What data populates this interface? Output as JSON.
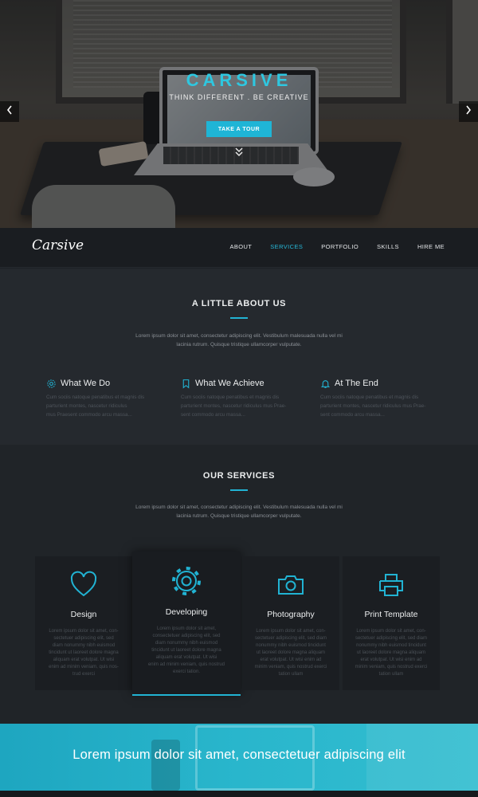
{
  "hero": {
    "brand": "CARSIVE",
    "tagline": "THINK DIFFERENT . BE CREATIVE",
    "cta_label": "TAKE A TOUR",
    "prev_icon": "chevron-left-icon",
    "next_icon": "chevron-right-icon",
    "scroll_icon": "double-chevron-down-icon"
  },
  "nav": {
    "logo": "Carsive",
    "items": [
      {
        "label": "ABOUT",
        "active": false
      },
      {
        "label": "SERVICES",
        "active": true
      },
      {
        "label": "PORTFOLIO",
        "active": false
      },
      {
        "label": "SKILLS",
        "active": false
      },
      {
        "label": "HIRE ME",
        "active": false
      }
    ]
  },
  "about": {
    "title": "A LITTLE ABOUT US",
    "intro_line1": "Lorem ipsum dolor sit amet, consectetur adipiscing elit. Vestibulum malesuada nulla vel mi",
    "intro_line2": "lacinia rutrum. Quisque tristique ullamcorper vulputate.",
    "features": [
      {
        "icon": "gear-icon",
        "title": "What We Do",
        "line1": "Cum sociis natoque penatibus et magnis dis",
        "line2": "parturient montes, nascetur ridiculus",
        "line3": "mus Praesent commodo arcu massa..."
      },
      {
        "icon": "bookmark-icon",
        "title": "What We Achieve",
        "line1": "Cum sociis natoque penatibus et magnis dis",
        "line2": "parturient montes, nascetur ridiculus mus Prae-",
        "line3": "sent commodo arcu massa..."
      },
      {
        "icon": "bell-icon",
        "title": "At The End",
        "line1": "Cum sociis natoque penatibus et magnis dis",
        "line2": "parturient montes, nascetur ridiculus mus Prae-",
        "line3": "sent commodo arcu massa..."
      }
    ]
  },
  "services": {
    "title": "OUR SERVICES",
    "intro_line1": "Lorem ipsum dolor sit amet, consectetur adipiscing elit. Vestibulum malesuada nulla vel mi",
    "intro_line2": "lacinia rutrum. Quisque tristique ullamcorper vulputate.",
    "cards": [
      {
        "icon": "heart-icon",
        "name": "Design",
        "lines": [
          "Lorem ipsum dolor sit amet, con-",
          "sectetuer adipiscing elit, sed",
          "diam nonummy nibh euismod",
          "tincidunt ut laoreet dolore magna",
          "aliquam erat volutpat. Ut wisi",
          "enim ad minim veniam, quis nos-",
          "trud exerci"
        ]
      },
      {
        "icon": "gear-icon",
        "name": "Developing",
        "lines": [
          "Lorem ipsum dolor sit amet,",
          "consectetuer adipiscing elit, sed",
          "diam nonummy nibh euismod",
          "tincidunt ut laoreet dolore magna",
          "aliquam erat volutpat. Ut wisi",
          "enim ad minim veniam, quis nostrud",
          "exerci tation."
        ]
      },
      {
        "icon": "camera-icon",
        "name": "Photography",
        "lines": [
          "Lorem ipsum dolor sit amet, con-",
          "sectetuer adipiscing elit, sed diam",
          "nonummy nibh euismod tincidunt",
          "ut laoreet dolore magna aliquam",
          "erat volutpat. Ut wisi enim ad",
          "minim veniam, quis nostrud exerci",
          "tation ullam"
        ]
      },
      {
        "icon": "printer-icon",
        "name": "Print Template",
        "lines": [
          "Lorem ipsum dolor sit amet, con-",
          "sectetuer adipiscing elit, sed diam",
          "nonummy nibh euismod tincidunt",
          "ut laoreet dolore magna aliquam",
          "erat volutpat. Ut wisi enim ad",
          "minim veniam, quis nostrud exerci",
          "tation ullam"
        ]
      }
    ]
  },
  "banner": {
    "text": "Lorem ipsum dolor sit amet, consectetuer adipiscing elit"
  },
  "colors": {
    "accent": "#21b3d3",
    "nav_bg": "#1a1d21",
    "about_bg": "#25292e",
    "services_bg": "#202428"
  }
}
